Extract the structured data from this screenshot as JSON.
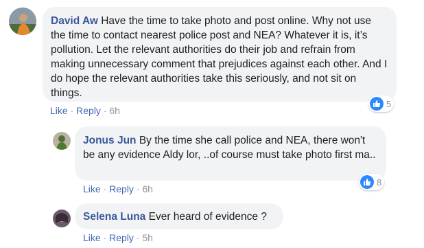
{
  "comments": [
    {
      "author": "David Aw",
      "text": "Have the time to take photo and post online. Why not use the time to contact nearest police post and NEA? Whatever it is, it’s pollution. Let the relevant authorities do their job and refrain from making unnecessary comment that prejudices against each other. And I do hope the relevant authorities take this seriously, and not sit on things.",
      "like_label": "Like",
      "reply_label": "Reply",
      "separator": "·",
      "time": "6h",
      "reactions": "5"
    },
    {
      "author": "Jonus Jun",
      "text": "By the time she call police and NEA, there won't be any evidence Aldy lor, ..of course must take photo first ma..",
      "like_label": "Like",
      "reply_label": "Reply",
      "separator": "·",
      "time": "6h",
      "reactions": "8"
    },
    {
      "author": "Selena Luna",
      "text": "Ever heard of evidence ?",
      "like_label": "Like",
      "reply_label": "Reply",
      "separator": "·",
      "time": "5h"
    }
  ],
  "colors": {
    "bubble": "#f2f3f5",
    "name": "#385898",
    "link": "#4267b2",
    "meta": "#90949c",
    "like_icon": "#2d88ff"
  },
  "icons": [
    "avatar",
    "like-reaction-icon"
  ]
}
